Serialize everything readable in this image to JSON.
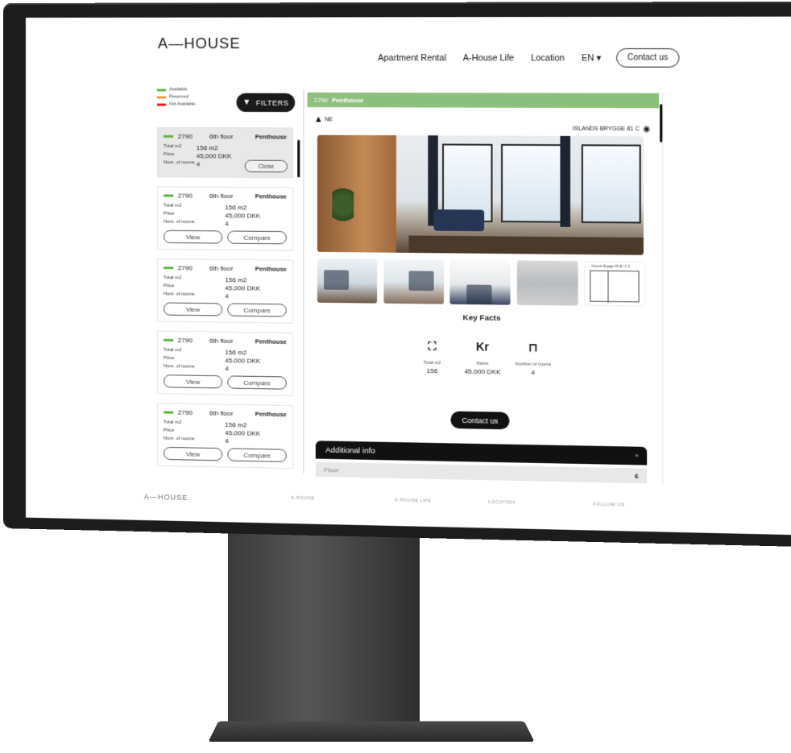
{
  "header": {
    "logo": "A—HOUSE",
    "nav": [
      "Apartment Rental",
      "A-House Life",
      "Location"
    ],
    "language": "EN ▾",
    "contact": "Contact us"
  },
  "legend": {
    "items": [
      {
        "label": "Available",
        "color": "#6ab04c"
      },
      {
        "label": "Reserved",
        "color": "#f39c3d"
      },
      {
        "label": "Not Available",
        "color": "#e02020"
      }
    ]
  },
  "filters_label": "FILTERS",
  "list": {
    "active": {
      "id": "2790",
      "floor": "6th floor",
      "type": "Penthouse",
      "rows": [
        {
          "k": "Total m2",
          "v": "156 m2"
        },
        {
          "k": "Price",
          "v": "45,000 DKK"
        },
        {
          "k": "Num. of rooms",
          "v": "4"
        }
      ],
      "close": "Close"
    },
    "cards": [
      {
        "id": "2790",
        "floor": "6th floor",
        "type": "Penthouse",
        "total_label": "Total m2",
        "total": "156 m2",
        "price_label": "Price",
        "price": "45,000 DKK",
        "rooms_label": "Num. of rooms",
        "rooms": "4",
        "view": "View",
        "compare": "Compare"
      },
      {
        "id": "2790",
        "floor": "6th floor",
        "type": "Penthouse",
        "total_label": "Total m2",
        "total": "156 m2",
        "price_label": "Price",
        "price": "45,000 DKK",
        "rooms_label": "Num. of rooms",
        "rooms": "4",
        "view": "View",
        "compare": "Compare"
      },
      {
        "id": "2790",
        "floor": "6th floor",
        "type": "Penthouse",
        "total_label": "Total m2",
        "total": "156 m2",
        "price_label": "Price",
        "price": "45,000 DKK",
        "rooms_label": "Num. of rooms",
        "rooms": "4",
        "view": "View",
        "compare": "Compare"
      },
      {
        "id": "2790",
        "floor": "6th floor",
        "type": "Penthouse",
        "total_label": "Total m2",
        "total": "156 m2",
        "price_label": "Price",
        "price": "45,000 DKK",
        "rooms_label": "Num. of rooms",
        "rooms": "4",
        "view": "View",
        "compare": "Compare"
      }
    ]
  },
  "detail": {
    "id": "2790",
    "name": "Penthouse",
    "compass": "NE",
    "address": "ISLANDS BRYGGE 81 C",
    "floorplan_label": "Islands Brygge 81 A / C 6",
    "key_facts_title": "Key Facts",
    "facts": [
      {
        "icon": "⛶",
        "label": "Total m2",
        "value": "156"
      },
      {
        "icon": "Kr",
        "label": "Name",
        "value": "45,000 DKK"
      },
      {
        "icon": "⊓",
        "label": "Number of rooms",
        "value": "4"
      }
    ],
    "contact": "Contact us",
    "additional_info": "Additional info",
    "floor_label": "Floor",
    "floor_value": "6"
  },
  "footer": {
    "logo": "A—HOUSE",
    "links": [
      "A-HOUSE",
      "A-HOUSE LIFE",
      "LOCATION",
      "FOLLOW US"
    ]
  }
}
